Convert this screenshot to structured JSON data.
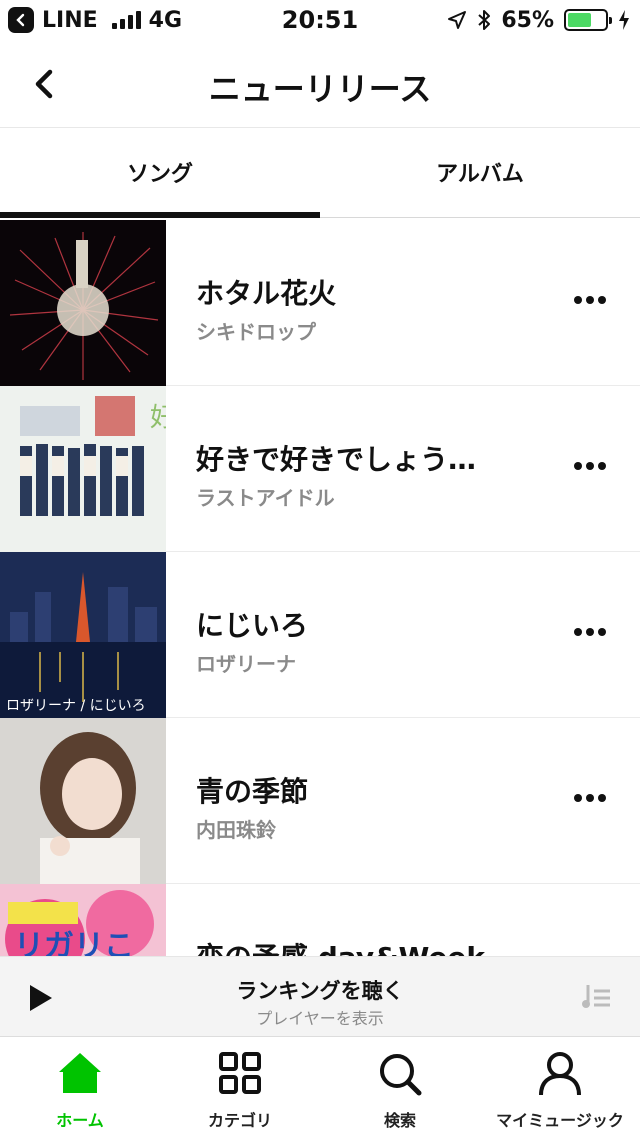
{
  "status_bar": {
    "carrier": "LINE",
    "network": "4G",
    "time": "20:51",
    "battery": "65%",
    "battery_level": 0.65
  },
  "header": {
    "title": "ニューリリース"
  },
  "tabs": [
    {
      "label": "ソング",
      "active": true
    },
    {
      "label": "アルバム",
      "active": false
    }
  ],
  "songs": [
    {
      "title": "ホタル花火",
      "artist": "シキドロップ"
    },
    {
      "title": "好きで好きでしょう…",
      "artist": "ラストアイドル"
    },
    {
      "title": "にじいろ",
      "artist": "ロザリーナ"
    },
    {
      "title": "青の季節",
      "artist": "内田珠鈴"
    },
    {
      "title": "恋の予感 day&Week",
      "artist": ""
    }
  ],
  "player": {
    "title": "ランキングを聴く",
    "subtitle": "プレイヤーを表示"
  },
  "tabbar": [
    {
      "label": "ホーム",
      "icon": "home-icon",
      "active": true
    },
    {
      "label": "カテゴリ",
      "icon": "grid-icon",
      "active": false
    },
    {
      "label": "検索",
      "icon": "search-icon",
      "active": false
    },
    {
      "label": "マイミュージック",
      "icon": "person-icon",
      "active": false
    }
  ],
  "colors": {
    "accent": "#00c300",
    "battery": "#4cd964"
  }
}
